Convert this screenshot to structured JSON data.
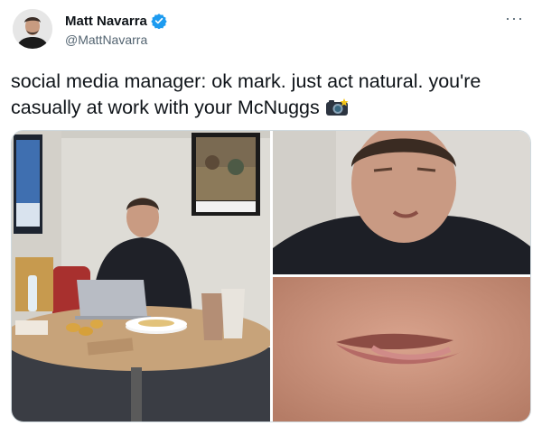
{
  "author": {
    "display_name": "Matt Navarra",
    "handle": "@MattNavarra",
    "verified": true,
    "avatar_icon": "user-avatar"
  },
  "menu": {
    "icon": "more-options-icon",
    "glyph": "···"
  },
  "tweet": {
    "text": "social media manager:  ok mark. just act natural. you're casually at work with your McNuggs",
    "emoji_icon": "camera-flash-icon"
  },
  "media": {
    "photos": [
      {
        "name": "office-photo"
      },
      {
        "name": "face-closeup-photo"
      },
      {
        "name": "lips-closeup-photo"
      }
    ]
  },
  "colors": {
    "text": "#0f1419",
    "secondary": "#536471",
    "verified": "#1d9bf0",
    "border": "#cfd9de"
  }
}
